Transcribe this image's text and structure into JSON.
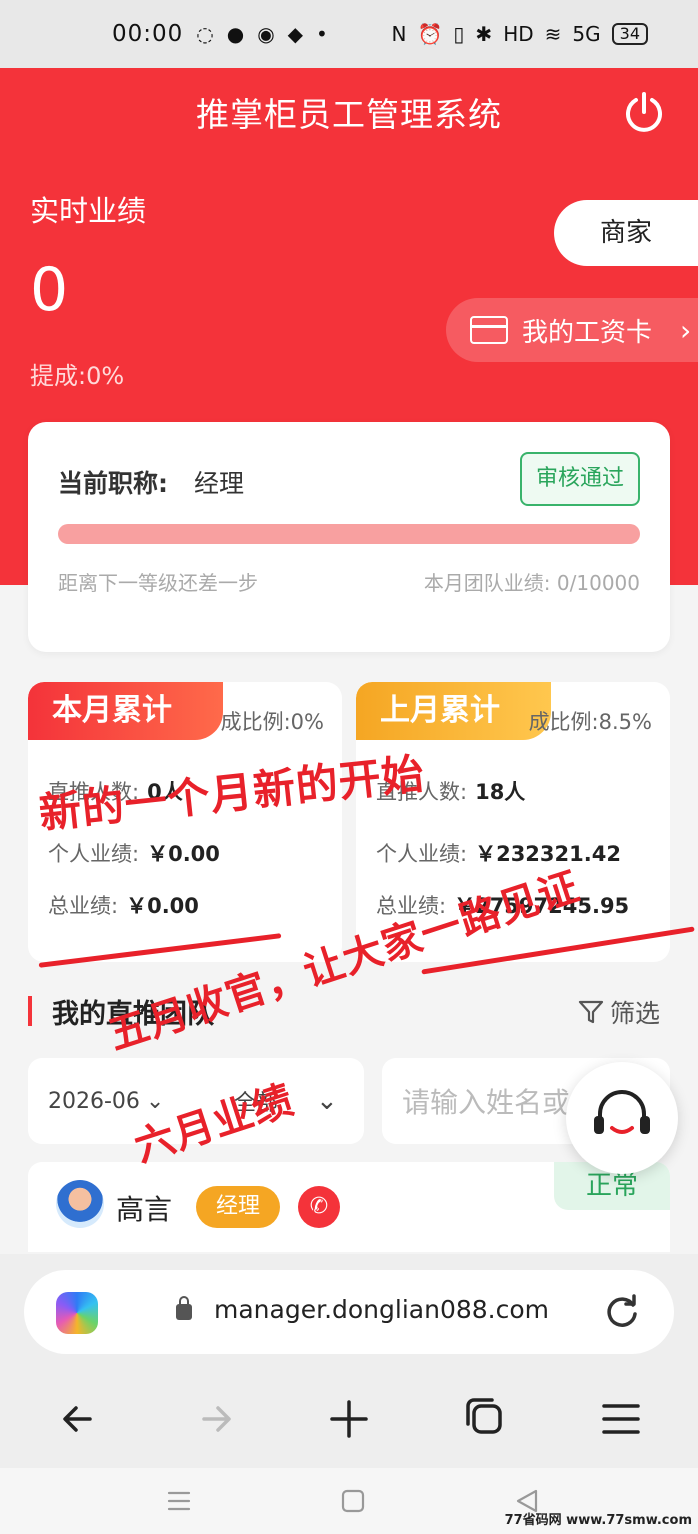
{
  "status_bar": {
    "time": "00:00",
    "battery": "34",
    "network": "5G",
    "hd": "HD"
  },
  "header": {
    "title": "推掌柜员工管理系统"
  },
  "performance": {
    "label": "实时业绩",
    "value": "0",
    "commission": "提成:0%"
  },
  "actions": {
    "merchant": "商家",
    "salary_card": "我的工资卡"
  },
  "level_card": {
    "title_label": "当前职称:",
    "title_value": "经理",
    "badge": "审核通过",
    "progress": 0,
    "next_level_text": "距离下一等级还差一步",
    "team_perf_text": "本月团队业绩: 0/10000"
  },
  "this_month": {
    "ribbon": "本月累计",
    "ratio": "成比例:0%",
    "direct_label": "直推人数:",
    "direct_value": "0人",
    "personal_label": "个人业绩:",
    "personal_value": "￥0.00",
    "total_label": "总业绩:",
    "total_value": "￥0.00"
  },
  "last_month": {
    "ribbon": "上月累计",
    "ratio": "成比例:8.5%",
    "direct_label": "直推人数:",
    "direct_value": "18人",
    "personal_label": "个人业绩:",
    "personal_value": "￥232321.42",
    "total_label": "总业绩:",
    "total_value": "￥27597245.95"
  },
  "overlay": {
    "line1": "新的一个月新的开始",
    "line2": "五月收官，让大家一路见证",
    "line3": "六月业绩"
  },
  "team": {
    "title": "我的直推团队",
    "filter": "筛选",
    "month": "2026-06",
    "all": "全部",
    "search_placeholder": "请输入姓名或"
  },
  "member": {
    "name": "高言",
    "role": "经理",
    "status": "正常"
  },
  "browser": {
    "url": "manager.donglian088.com"
  },
  "watermark": "77省码网 www.77smw.com",
  "colors": {
    "brand_red": "#f4333a",
    "gold": "#f5a623",
    "success": "#2aa55c"
  }
}
